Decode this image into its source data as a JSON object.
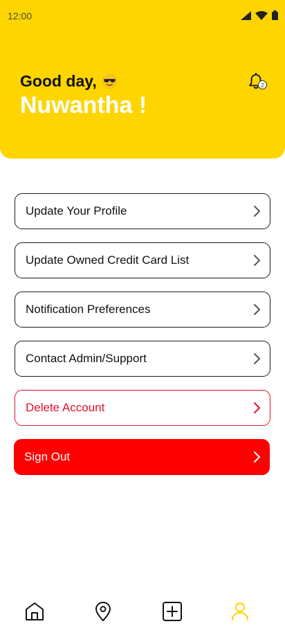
{
  "status_bar": {
    "time": "12:00",
    "icons": [
      "cellular-icon",
      "wifi-icon",
      "battery-icon"
    ]
  },
  "header": {
    "greeting": "Good day,",
    "greeting_emoji": "smiling-face-with-sunglasses",
    "username": "Nuwantha !",
    "notification_count": "2",
    "background_color": "#FFD500"
  },
  "menu": {
    "items": [
      {
        "label": "Update Your Profile"
      },
      {
        "label": "Update Owned Credit Card List"
      },
      {
        "label": "Notification Preferences"
      },
      {
        "label": "Contact Admin/Support"
      },
      {
        "label": "Delete Account"
      },
      {
        "label": "Sign Out"
      }
    ]
  },
  "colors": {
    "accent": "#FFD500",
    "danger": "#E0102B",
    "signout_bg": "#FF0000"
  },
  "bottom_nav": {
    "items": [
      {
        "icon": "home-icon"
      },
      {
        "icon": "location-pin-icon"
      },
      {
        "icon": "add-square-icon"
      },
      {
        "icon": "profile-icon",
        "active": true
      }
    ]
  }
}
